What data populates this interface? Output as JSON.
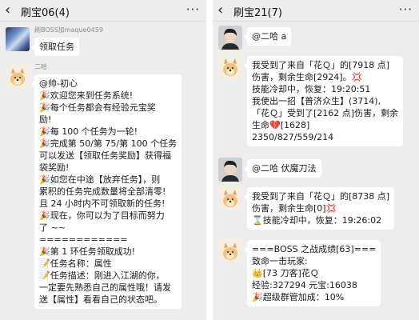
{
  "left": {
    "title": "刷宝06(4)",
    "back_icon": "‹",
    "more_icon": "···",
    "messages": [
      {
        "nick": "刷BOSS加maque0459",
        "lines": [
          "领取任务"
        ]
      },
      {
        "nick": "二哈",
        "lines": [
          "@帅-初心",
          "🎉欢迎您来到任务系统!",
          "🎉每个任务都会有经验元宝奖",
          "励!",
          "🎉每 100 个任务为一轮!",
          "🎉完成第 50/第 75/第 100 个任务",
          "可以发送【领取任务奖励】获得福",
          "袋奖励!",
          "🎉如您在中途【放弃任务】，则",
          "累积的任务完成数量将全部清零!",
          "且 24 小时内不可领取新的任务!",
          "🎉现在，你可以为了目标而努力",
          "了 ~~",
          "============",
          "🎉第 1 环任务领取成功!",
          "📝任务名称：属性",
          "📝任务描述：刚进入江湖的你，",
          "一定要先熟悉自己的属性哦！请发",
          "送【属性】看看自己的状态吧。"
        ]
      }
    ]
  },
  "right": {
    "title": "刷宝21(7)",
    "back_icon": "‹",
    "more_icon": "···",
    "messages": [
      {
        "lines": [
          "@二哈 a"
        ]
      },
      {
        "lines": [
          "我受到了来自「花Ｑ」的[7918 点]",
          "伤害，剩余生命[2924]。💢",
          "技能冷却中，恢复：19:20:51",
          "我使出一招【普济众生】(3714),",
          "「花Ｑ」受到了[2162 点]伤害，剩余",
          "生命💔[1628]",
          "2350/827/559/214"
        ]
      },
      {
        "lines": [
          "@二哈  伏魔刀法"
        ]
      },
      {
        "lines": [
          "我受到了来自「花Ｑ」的[8738 点]",
          "伤害，剩余生命[0]💢",
          "⌛技能冷却中，恢复：19:26:02"
        ]
      },
      {
        "lines": [
          "===BOSS 之战成绩[63]===",
          "致命一击玩家:",
          "👑[73 刀客]花Ｑ",
          "经验:327294 元宝:16038",
          "🎉超级群管加成：10%"
        ]
      }
    ]
  }
}
